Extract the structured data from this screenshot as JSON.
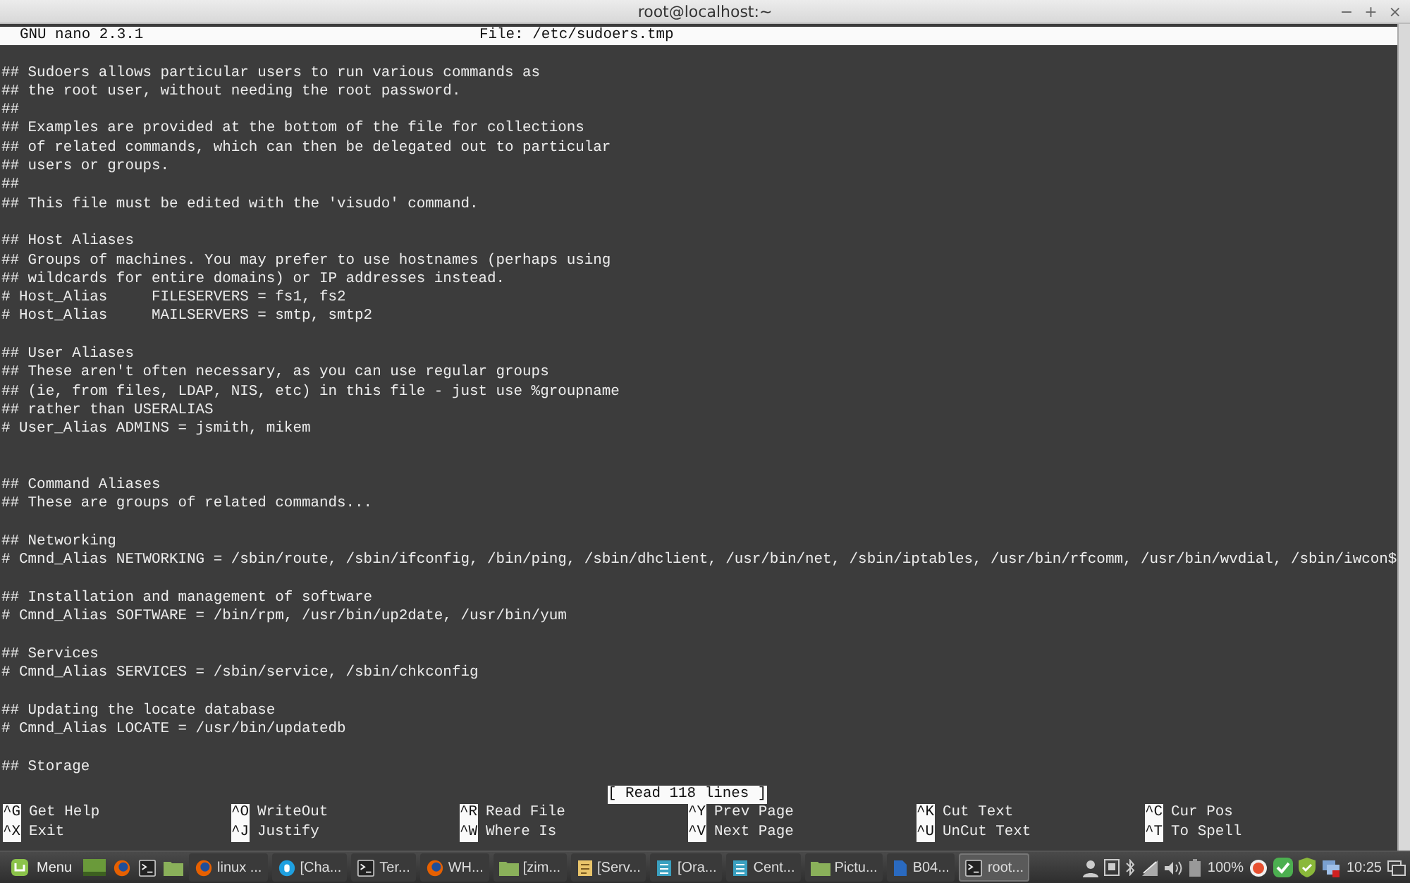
{
  "window": {
    "title": "root@localhost:~",
    "controls": [
      "−",
      "+",
      "×"
    ]
  },
  "nano": {
    "version": "GNU nano 2.3.1",
    "file": "File: /etc/sudoers.tmp",
    "blocks": [
      {
        "extra_gap": false,
        "lines": [
          "## Sudoers allows particular users to run various commands as",
          "## the root user, without needing the root password.",
          "##",
          "## Examples are provided at the bottom of the file for collections",
          "## of related commands, which can then be delegated out to particular",
          "## users or groups.",
          "##",
          "## This file must be edited with the 'visudo' command."
        ]
      },
      {
        "extra_gap": false,
        "lines": [
          "## Host Aliases",
          "## Groups of machines. You may prefer to use hostnames (perhaps using",
          "## wildcards for entire domains) or IP addresses instead.",
          "# Host_Alias     FILESERVERS = fs1, fs2",
          "# Host_Alias     MAILSERVERS = smtp, smtp2"
        ]
      },
      {
        "extra_gap": false,
        "lines": [
          "## User Aliases",
          "## These aren't often necessary, as you can use regular groups",
          "## (ie, from files, LDAP, NIS, etc) in this file - just use %groupname",
          "## rather than USERALIAS",
          "# User_Alias ADMINS = jsmith, mikem"
        ]
      },
      {
        "extra_gap": true,
        "lines": [
          "## Command Aliases",
          "## These are groups of related commands..."
        ]
      },
      {
        "extra_gap": false,
        "lines": [
          "## Networking",
          "# Cmnd_Alias NETWORKING = /sbin/route, /sbin/ifconfig, /bin/ping, /sbin/dhclient, /usr/bin/net, /sbin/iptables, /usr/bin/rfcomm, /usr/bin/wvdial, /sbin/iwcon$"
        ]
      },
      {
        "extra_gap": false,
        "lines": [
          "## Installation and management of software",
          "# Cmnd_Alias SOFTWARE = /bin/rpm, /usr/bin/up2date, /usr/bin/yum"
        ]
      },
      {
        "extra_gap": false,
        "lines": [
          "## Services",
          "# Cmnd_Alias SERVICES = /sbin/service, /sbin/chkconfig"
        ]
      },
      {
        "extra_gap": false,
        "lines": [
          "## Updating the locate database",
          "# Cmnd_Alias LOCATE = /usr/bin/updatedb"
        ]
      },
      {
        "extra_gap": false,
        "lines": [
          "## Storage"
        ]
      }
    ],
    "status": "[ Read 118 lines ]",
    "shortcuts": [
      [
        {
          "key": "^G",
          "label": "Get Help"
        },
        {
          "key": "^X",
          "label": "Exit"
        }
      ],
      [
        {
          "key": "^O",
          "label": "WriteOut"
        },
        {
          "key": "^J",
          "label": "Justify"
        }
      ],
      [
        {
          "key": "^R",
          "label": "Read File"
        },
        {
          "key": "^W",
          "label": "Where Is"
        }
      ],
      [
        {
          "key": "^Y",
          "label": "Prev Page"
        },
        {
          "key": "^V",
          "label": "Next Page"
        }
      ],
      [
        {
          "key": "^K",
          "label": "Cut Text"
        },
        {
          "key": "^U",
          "label": "UnCut Text"
        }
      ],
      [
        {
          "key": "^C",
          "label": "Cur Pos"
        },
        {
          "key": "^T",
          "label": "To Spell"
        }
      ]
    ]
  },
  "taskbar": {
    "menu": "Menu",
    "tasks": [
      {
        "label": "linux ...",
        "kind": "browser",
        "selected": false
      },
      {
        "label": "[Cha...",
        "kind": "chat",
        "selected": false
      },
      {
        "label": "Ter...",
        "kind": "terminal",
        "selected": false
      },
      {
        "label": "WH...",
        "kind": "browser",
        "selected": false
      },
      {
        "label": "[zim...",
        "kind": "folder",
        "selected": false
      },
      {
        "label": "[Serv...",
        "kind": "notes",
        "selected": false
      },
      {
        "label": "[Ora...",
        "kind": "writer",
        "selected": false
      },
      {
        "label": "Cent...",
        "kind": "writer",
        "selected": false
      },
      {
        "label": "Pictu...",
        "kind": "folder",
        "selected": false
      },
      {
        "label": "B04...",
        "kind": "doc",
        "selected": false
      },
      {
        "label": "root...",
        "kind": "terminal",
        "selected": true
      }
    ],
    "battery": "100%",
    "clock": "10:25"
  }
}
